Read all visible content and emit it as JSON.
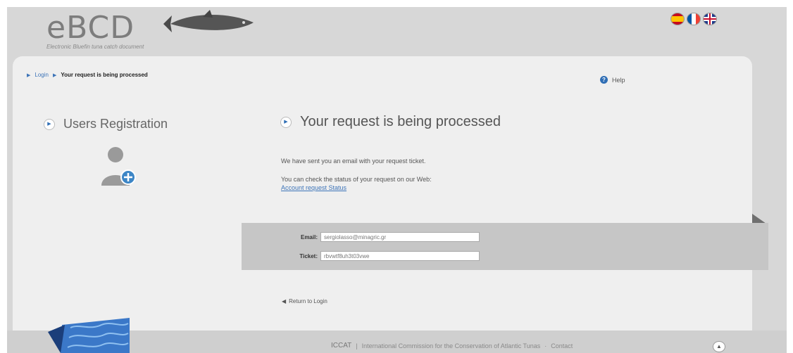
{
  "header": {
    "logo_text": "eBCD",
    "logo_subtitle": "Electronic Bluefin tuna catch document",
    "languages": [
      "ES",
      "FR",
      "EN"
    ]
  },
  "breadcrumb": {
    "items": [
      "Login",
      "Your request is being processed"
    ]
  },
  "help": {
    "label": "Help"
  },
  "sidebar": {
    "title": "Users Registration"
  },
  "main": {
    "title": "Your request is being processed",
    "message1": "We have sent you an email with your request ticket.",
    "message2": "You can check the status of your request on our Web:",
    "status_link": "Account request Status",
    "form": {
      "email_label": "Email:",
      "email_value": "sergiolasso@minagric.gr",
      "ticket_label": "Ticket:",
      "ticket_value": "rbvwtf8uh3t03vwe"
    },
    "return_link": "Return to Login"
  },
  "footer": {
    "org": "ICCAT",
    "text": "International Commission for the Conservation of Atlantic Tunas",
    "contact": "Contact"
  },
  "colors": {
    "link": "#3d74b8",
    "panel": "#efefef",
    "strip": "#c6c6c6"
  }
}
